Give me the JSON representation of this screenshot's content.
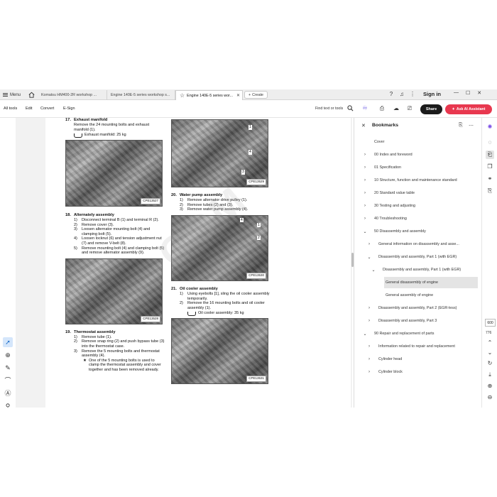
{
  "titlebar": {
    "menu_label": "Menu",
    "tabs": [
      {
        "label": "Komatsu HM400-2R workshop ..."
      },
      {
        "label": "Engine 140E-5 series workshop s..."
      },
      {
        "label": "Engine 140E-5 series wor..."
      }
    ],
    "create_label": "Create",
    "signin_label": "Sign in",
    "icons": [
      "help-icon",
      "bell-icon",
      "apps-grid-icon"
    ]
  },
  "toolbar": {
    "menus": [
      "All tools",
      "Edit",
      "Convert",
      "E-Sign"
    ],
    "find_label": "Find text or tools",
    "share_label": "Share",
    "ai_label": "Ask AI Assistant"
  },
  "document": {
    "watermark": "COM",
    "left": {
      "sec17": {
        "num": "17.",
        "title": "Exhaust manifold",
        "text": "Remove the 24 mounting bolts and exhaust manifold (1).",
        "weight": "Exhaust manifold: 25 kg",
        "photo_code": "CPE13527"
      },
      "sec18": {
        "num": "18.",
        "title": "Alternately assembly",
        "steps": [
          {
            "n": "1)",
            "t": "Disconnect terminal B (1) and terminal R (2)."
          },
          {
            "n": "2)",
            "t": "Remove cover (3)."
          },
          {
            "n": "3)",
            "t": "Loosen alternator mounting bolt (4) and clamping bolt (5)."
          },
          {
            "n": "4)",
            "t": "Loosen locknut (6) and tension adjustment nut (7) and remove V-belt (8)."
          },
          {
            "n": "5)",
            "t": "Remove mounting bolt (4) and clamping bolt (5) and remove alternator assembly (9)."
          }
        ],
        "photo_code": "CPE13528"
      },
      "sec19": {
        "num": "19.",
        "title": "Thermostat assembly",
        "steps": [
          {
            "n": "1)",
            "t": "Remove tube (1)."
          },
          {
            "n": "2)",
            "t": "Remove snap ring (2) and push bypass tube (3) into the thermostat case."
          },
          {
            "n": "3)",
            "t": "Remove the 5 mounting bolts and thermostat assembly (4)."
          }
        ],
        "note": "One of the 5 mounting bolts is used to clamp the thermostat assembly and cover together and has been removed already.",
        "bullet": "★"
      }
    },
    "right": {
      "photo_top_code": "CPE13529",
      "sec20": {
        "num": "20.",
        "title": "Water pump assembly",
        "steps": [
          {
            "n": "1)",
            "t": "Remove alternator drive pulley (1)."
          },
          {
            "n": "2)",
            "t": "Remove tubes (2) and (3)."
          },
          {
            "n": "3)",
            "t": "Remove water pump assembly (4)."
          }
        ],
        "photo_code": "CPE13530"
      },
      "sec21": {
        "num": "21.",
        "title": "Oil cooler assembly",
        "steps": [
          {
            "n": "1)",
            "t": "Using eyebolts [1], sling the oil cooler assembly temporarily."
          },
          {
            "n": "2)",
            "t": "Remove the 16 mounting bolts and oil cooler assembly (1)."
          }
        ],
        "weight": "Oil cooler assembly: 35 kg",
        "photo_code": "CPE13531"
      }
    }
  },
  "bookmarks": {
    "title": "Bookmarks",
    "items": [
      {
        "label": "Cover",
        "level": 0,
        "chevron": ""
      },
      {
        "label": "00 Index and foreword",
        "level": 0,
        "chevron": "›"
      },
      {
        "label": "01 Specification",
        "level": 0,
        "chevron": "›"
      },
      {
        "label": "10 Structure, function and maintenance standard",
        "level": 0,
        "chevron": "›"
      },
      {
        "label": "20 Standard value table",
        "level": 0,
        "chevron": "›"
      },
      {
        "label": "30 Testing and adjusting",
        "level": 0,
        "chevron": "›"
      },
      {
        "label": "40 Troubleshooting",
        "level": 0,
        "chevron": "›"
      },
      {
        "label": "50 Disassembly and assembly",
        "level": 0,
        "chevron": "⌄"
      },
      {
        "label": "General information on disassembly and asse...",
        "level": 1,
        "chevron": "›"
      },
      {
        "label": "Disassembly and assembly, Part 1 (with EGR)",
        "level": 1,
        "chevron": "⌄"
      },
      {
        "label": "Disassembly and assembly, Part 1 (with EGR)",
        "level": 2,
        "chevron": "⌄"
      },
      {
        "label": "General disassembly of engine",
        "level": 3,
        "chevron": "",
        "selected": true
      },
      {
        "label": "General assembly of engine",
        "level": 3,
        "chevron": ""
      },
      {
        "label": "Disassembly and assembly, Part 2 (EGR-less)",
        "level": 1,
        "chevron": "›"
      },
      {
        "label": "Disassembly and assembly, Part 3",
        "level": 1,
        "chevron": "›"
      },
      {
        "label": "90 Repair and replacement of parts",
        "level": 0,
        "chevron": "⌄"
      },
      {
        "label": "Information related to repair and replacement",
        "level": 1,
        "chevron": "›"
      },
      {
        "label": "Cylinder head",
        "level": 1,
        "chevron": "›"
      },
      {
        "label": "Cylinder block",
        "level": 1,
        "chevron": "›"
      }
    ]
  },
  "pagination": {
    "current": "600",
    "total": "776"
  },
  "colors": {
    "ai_button": "#e8384f",
    "share_button": "#1b1b1b",
    "active_tool": "#d4e6fb"
  }
}
